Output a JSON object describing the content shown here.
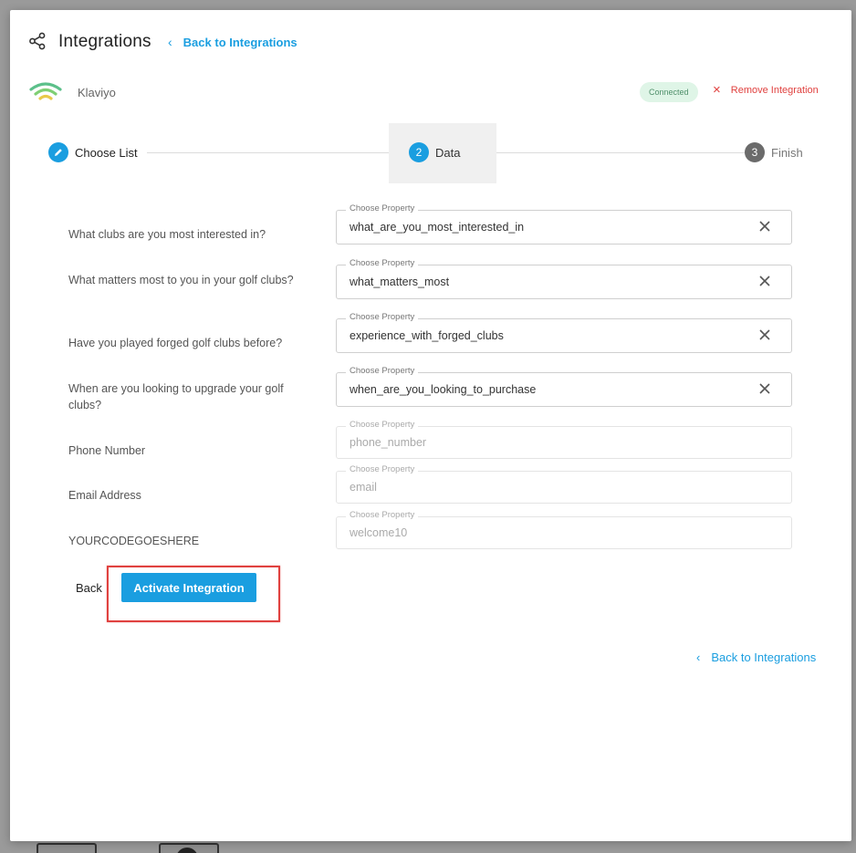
{
  "header": {
    "title": "Integrations",
    "back_link": "Back to Integrations"
  },
  "provider": {
    "name": "Klaviyo",
    "status": "Connected",
    "remove_label": "Remove Integration"
  },
  "stepper": {
    "steps": [
      {
        "number": "1",
        "label": "Choose List",
        "state": "completed"
      },
      {
        "number": "2",
        "label": "Data",
        "state": "active"
      },
      {
        "number": "3",
        "label": "Finish",
        "state": "pending"
      }
    ]
  },
  "mappings": [
    {
      "question": "What clubs are you most interested in?",
      "legend": "Choose Property",
      "value": "what_are_you_most_interested_in",
      "disabled": false
    },
    {
      "question": "What matters most to you in your golf clubs?",
      "legend": "Choose Property",
      "value": "what_matters_most",
      "disabled": false
    },
    {
      "question": "Have you played forged golf clubs before?",
      "legend": "Choose Property",
      "value": "experience_with_forged_clubs",
      "disabled": false
    },
    {
      "question": "When are you looking to upgrade your golf clubs?",
      "legend": "Choose Property",
      "value": "when_are_you_looking_to_purchase",
      "disabled": false
    },
    {
      "question": "Phone Number",
      "legend": "Choose Property",
      "value": "phone_number",
      "disabled": true
    },
    {
      "question": "Email Address",
      "legend": "Choose Property",
      "value": "email",
      "disabled": true
    },
    {
      "question": "YOURCODEGOESHERE",
      "legend": "Choose Property",
      "value": "welcome10",
      "disabled": true
    }
  ],
  "actions": {
    "back_label": "Back",
    "activate_label": "Activate Integration"
  },
  "footer": {
    "back_link": "Back to Integrations"
  },
  "colors": {
    "accent": "#1a9ee0",
    "danger": "#e0413f",
    "success_bg": "#dff5e7"
  }
}
